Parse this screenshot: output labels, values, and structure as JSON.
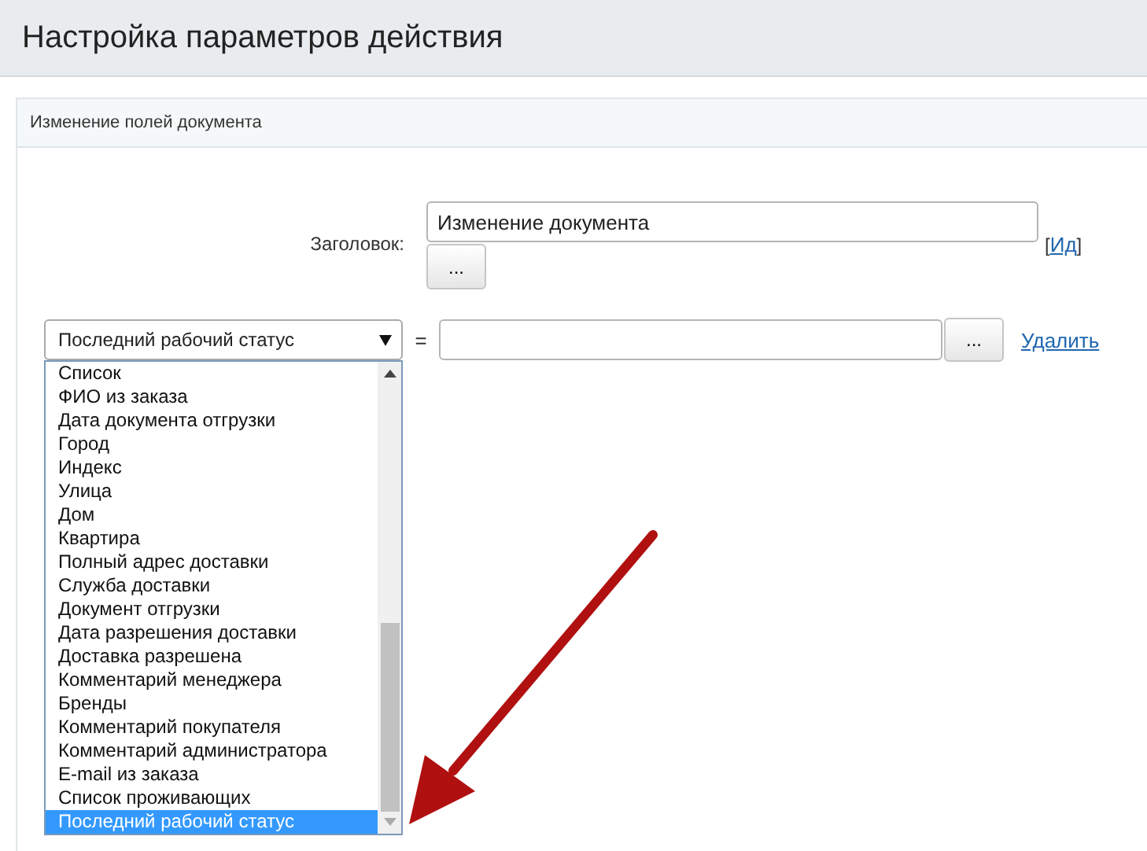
{
  "window": {
    "title": "Настройка параметров действия"
  },
  "panel": {
    "title": "Изменение полей документа"
  },
  "title_field": {
    "label": "Заголовок:",
    "value": "Изменение документа",
    "button": "...",
    "link": "Ид",
    "link_open": "[",
    "link_close": "]"
  },
  "condition": {
    "select": "Последний рабочий статус",
    "operator": "=",
    "button": "...",
    "delete_link": "Удалить"
  },
  "dropdown": {
    "items": [
      {
        "label": "Список",
        "selected": false
      },
      {
        "label": "ФИО из заказа",
        "selected": false
      },
      {
        "label": "Дата документа отгрузки",
        "selected": false
      },
      {
        "label": "Город",
        "selected": false
      },
      {
        "label": "Индекс",
        "selected": false
      },
      {
        "label": "Улица",
        "selected": false
      },
      {
        "label": "Дом",
        "selected": false
      },
      {
        "label": "Квартира",
        "selected": false
      },
      {
        "label": "Полный адрес доставки",
        "selected": false
      },
      {
        "label": "Служба доставки",
        "selected": false
      },
      {
        "label": "Документ отгрузки",
        "selected": false
      },
      {
        "label": "Дата разрешения доставки",
        "selected": false
      },
      {
        "label": "Доставка разрешена",
        "selected": false
      },
      {
        "label": "Комментарий менеджера",
        "selected": false
      },
      {
        "label": "Бренды",
        "selected": false
      },
      {
        "label": "Комментарий покупателя",
        "selected": false
      },
      {
        "label": "Комментарий администратора",
        "selected": false
      },
      {
        "label": "E-mail из заказа",
        "selected": false
      },
      {
        "label": "Список проживающих",
        "selected": false
      },
      {
        "label": "Последний рабочий статус",
        "selected": true
      }
    ]
  }
}
